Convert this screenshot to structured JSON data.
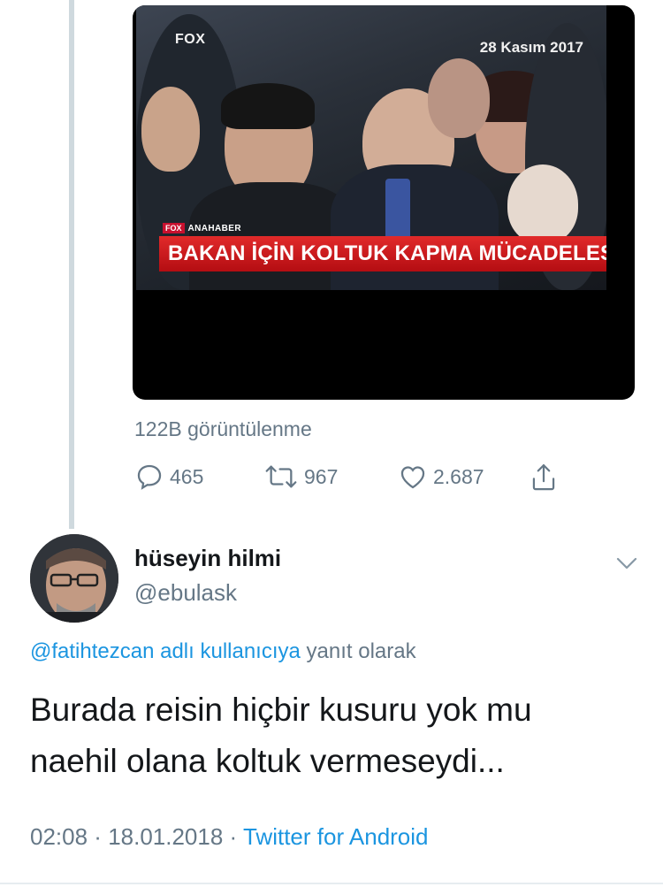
{
  "video": {
    "channel_logo": "FOX",
    "date_badge": "28 Kasım 2017",
    "strap_logo": "FOX",
    "strap_tag": "ANAHABER",
    "headline": "BAKAN İÇİN KOLTUK KAPMA MÜCADELESİ"
  },
  "views": "122B görüntülenme",
  "actions": {
    "reply_count": "465",
    "retweet_count": "967",
    "like_count": "2.687",
    "reply_icon": "reply-icon",
    "retweet_icon": "retweet-icon",
    "like_icon": "heart-icon",
    "share_icon": "share-icon"
  },
  "reply": {
    "display_name": "hüseyin hilmi",
    "handle": "@ebulask",
    "reply_to_link": "@fatihtezcan adlı kullanıcıya",
    "reply_to_rest": " yanıt olarak",
    "text_line1": "Burada reisin hiçbir kusuru yok mu",
    "text_line2": "naehil olana koltuk vermeseydi...",
    "time": "02:08",
    "date": "18.01.2018",
    "source": "Twitter for Android",
    "separator": " · "
  },
  "colors": {
    "link": "#1b95e0",
    "muted": "#657786",
    "text": "#14171a",
    "thread_line": "#cfd9de",
    "strap_red": "#c8102e"
  }
}
